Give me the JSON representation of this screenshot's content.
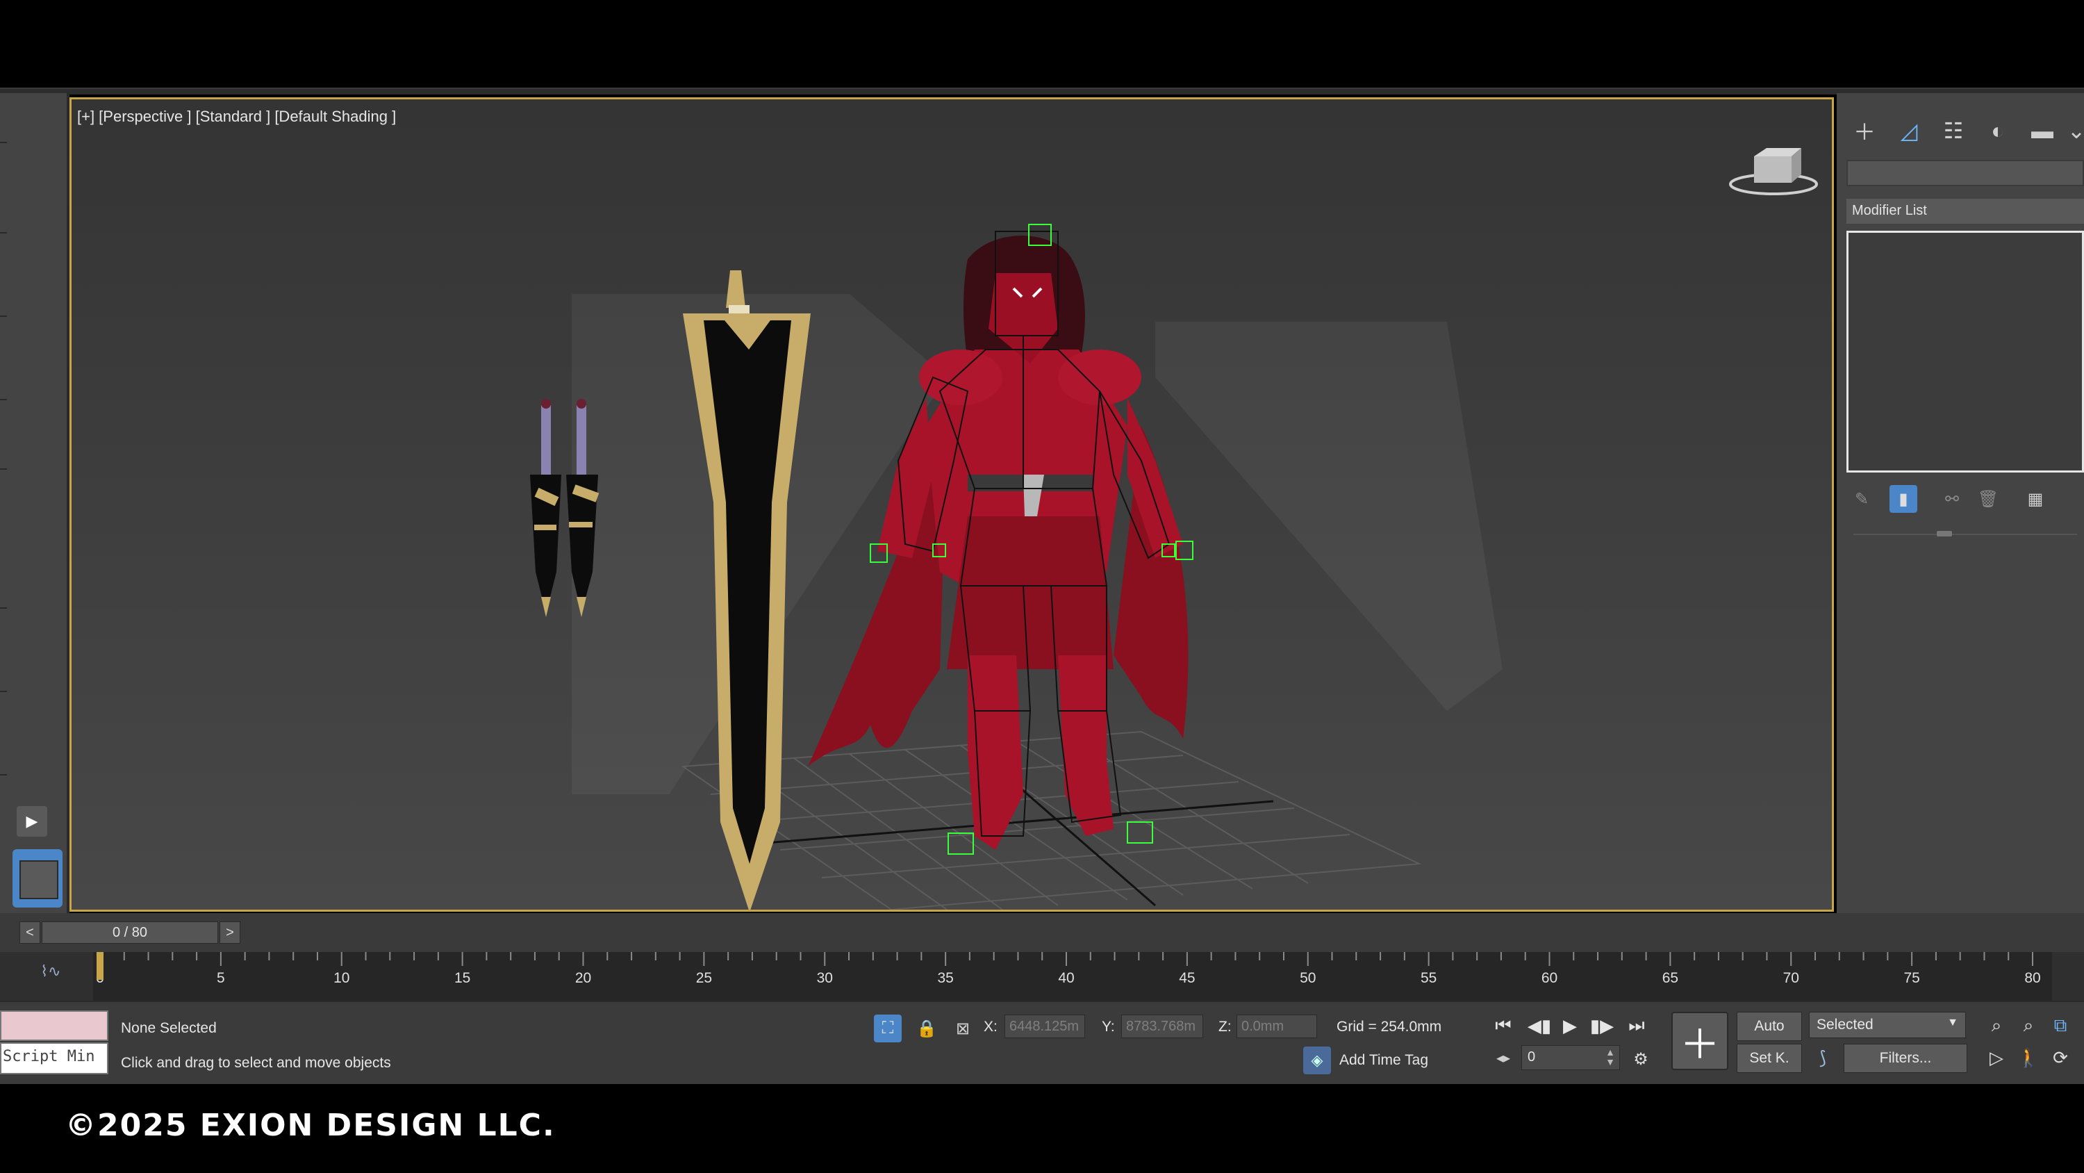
{
  "viewport": {
    "label": "[+] [Perspective ] [Standard ] [Default Shading ]"
  },
  "command_panel": {
    "tabs": [
      "create-icon",
      "modify-icon",
      "hierarchy-icon",
      "motion-icon",
      "display-icon"
    ],
    "modifier_list_label": "Modifier List",
    "stack_tools": [
      "pin-stack-icon",
      "show-end-result-icon",
      "make-unique-icon",
      "remove-modifier-icon",
      "configure-sets-icon"
    ]
  },
  "time_slider": {
    "prev": "<",
    "frame_label": "0 / 80",
    "next": ">"
  },
  "track_bar": {
    "ticks": [
      "0",
      "5",
      "10",
      "15",
      "20",
      "25",
      "30",
      "35",
      "40",
      "45",
      "50",
      "55",
      "60",
      "65",
      "70",
      "75",
      "80"
    ],
    "current_frame": 0
  },
  "status_bar": {
    "maxscript_label": "Script Min",
    "selection_text": "None Selected",
    "prompt_text": "Click and drag to select and move objects",
    "coords": {
      "x_label": "X:",
      "x_value": "6448.125m",
      "y_label": "Y:",
      "y_value": "8783.768m",
      "z_label": "Z:",
      "z_value": "0.0mm"
    },
    "grid_text": "Grid = 254.0mm",
    "time_tag_label": "Add Time Tag",
    "frame_spinner_value": "0",
    "auto_key_label": "Auto",
    "set_key_label": "Set K.",
    "key_filter_selected": "Selected",
    "filters_label": "Filters..."
  },
  "footer": {
    "copyright": "©2025 EXION DESIGN LLC."
  },
  "colors": {
    "viewport_border": "#c9a54a",
    "panel_bg": "#444444",
    "armor_red": "#a8132a",
    "sword_gold": "#c8ad6a",
    "selection_green": "#3cff3c",
    "maxscript_pink": "#e9c9cf"
  }
}
